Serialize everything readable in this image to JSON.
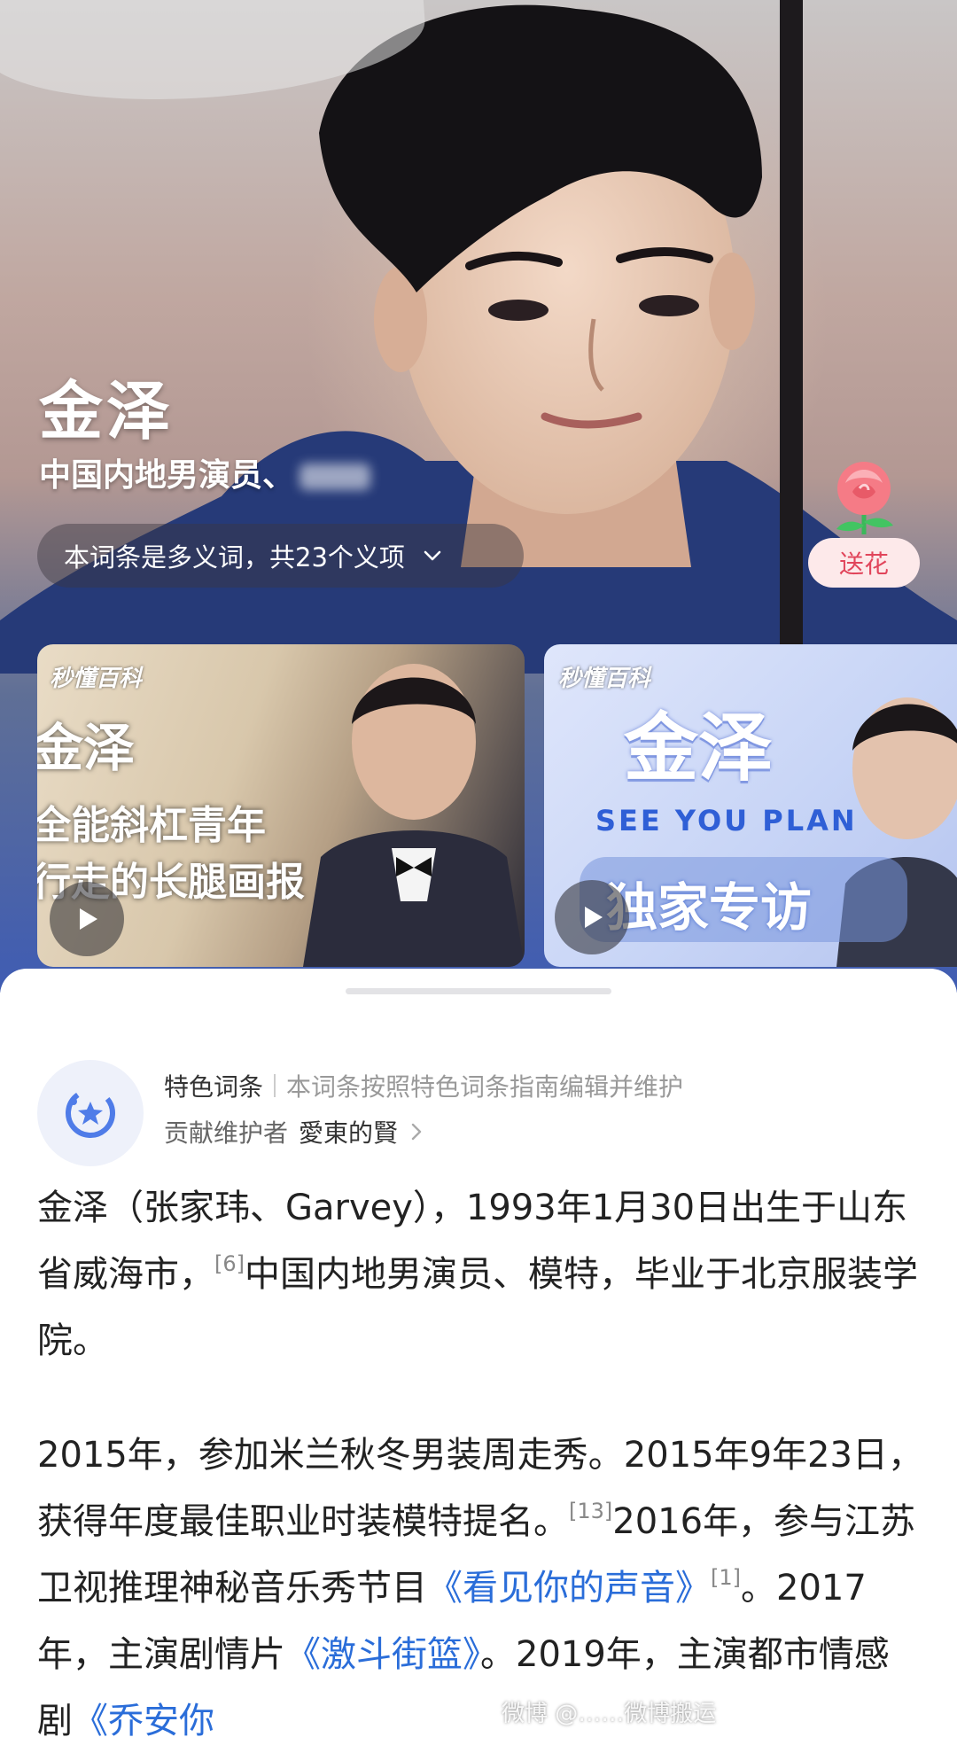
{
  "hero": {
    "title": "金泽",
    "subtitle": "中国内地男演员、",
    "polysemy_text": "本词条是多义词，共23个义项",
    "flower_button": "送花"
  },
  "videos": [
    {
      "brand": "秒懂百科",
      "line1": "金泽",
      "line2": "全能斜杠青年",
      "line3": "行走的长腿画报"
    },
    {
      "brand": "秒懂百科",
      "title": "金泽",
      "english": "SEE YOU PLAN",
      "subtitle": "独家专访"
    }
  ],
  "feature": {
    "label": "特色词条",
    "description": "本词条按照特色词条指南编辑并维护",
    "maintainer_label": "贡献维护者",
    "maintainer_name": "愛東的賢"
  },
  "summary": {
    "p1_a": "金泽（张家玮、Garvey），1993年1月30日出生于山东省威海市，",
    "p1_cite": "[6]",
    "p1_b": "中国内地男演员、模特，毕业于北京服装学院。",
    "p2_a": "2015年，参加米兰秋冬男装周走秀。2015年9年23日，获得年度最佳职业时装模特提名。",
    "p2_cite1": "[13]",
    "p2_b": "2016年，参与江苏卫视推理神秘音乐秀节目",
    "p2_link1": "《看见你的声音》",
    "p2_cite2": "[1]",
    "p2_c": "。2017年，主演剧情片",
    "p2_link2": "《激斗街篮》",
    "p2_d": "。2019年，主演都市情感剧",
    "p2_link3": "《乔安你"
  },
  "watermark": "微博 @……微博搬运",
  "colors": {
    "link": "#2a6dd9",
    "flower_text": "#e1455b",
    "flower_bg": "#fde9ea",
    "feature_icon": "#4f7ce8"
  },
  "icons": [
    "chevron-down-icon",
    "rose-icon",
    "play-icon",
    "feature-star-icon",
    "chevron-right-icon"
  ]
}
